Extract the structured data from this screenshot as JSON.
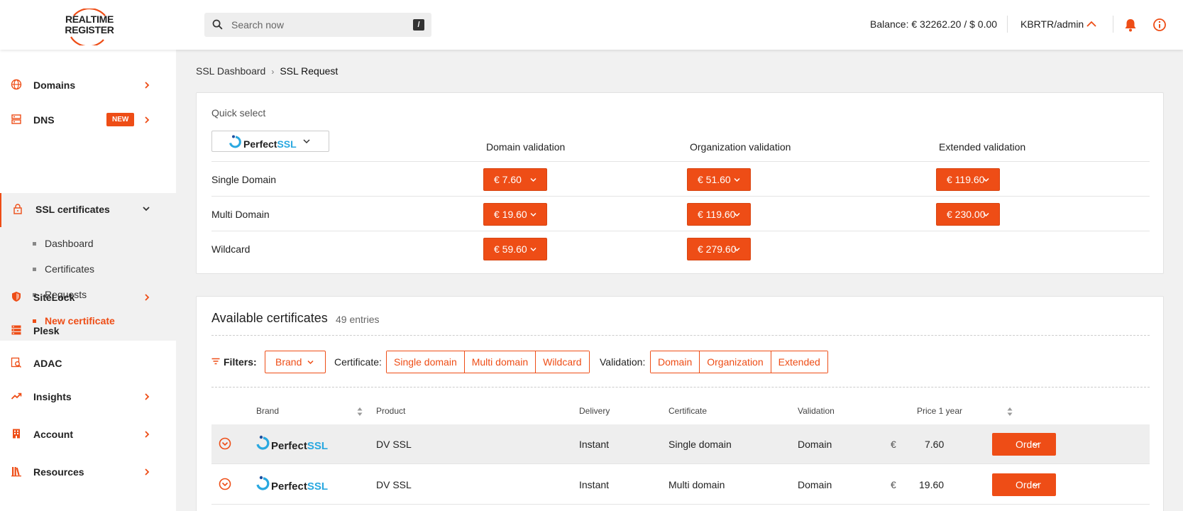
{
  "header": {
    "logo_line1": "REALTIME",
    "logo_line2": "REGISTER",
    "search_placeholder": "Search now",
    "search_shortcut": "/",
    "balance": "Balance: € 32262.20 / $ 0.00",
    "user": "KBRTR/admin"
  },
  "sidebar": {
    "items": [
      {
        "label": "Domains"
      },
      {
        "label": "DNS",
        "badge": "NEW"
      },
      {
        "label": "SSL certificates"
      },
      {
        "label": "SiteLock"
      },
      {
        "label": "Plesk"
      },
      {
        "label": "ADAC"
      },
      {
        "label": "Insights"
      },
      {
        "label": "Account"
      },
      {
        "label": "Resources"
      }
    ],
    "ssl_sub": [
      "Dashboard",
      "Certificates",
      "Requests",
      "New certificate"
    ]
  },
  "breadcrumb": {
    "parent": "SSL Dashboard",
    "separator": "›",
    "current": "SSL Request"
  },
  "quick_select": {
    "title": "Quick select",
    "brand": {
      "part1": "Perfect",
      "part2": "SSL"
    },
    "columns": [
      "Domain validation",
      "Organization validation",
      "Extended validation"
    ],
    "rows": [
      {
        "label": "Single Domain",
        "dv": "€ 7.60",
        "ov": "€ 51.60",
        "ev": "€ 119.60"
      },
      {
        "label": "Multi Domain",
        "dv": "€ 19.60",
        "ov": "€ 119.60",
        "ev": "€ 230.00"
      },
      {
        "label": "Wildcard",
        "dv": "€ 59.60",
        "ov": "€ 279.60"
      }
    ]
  },
  "available": {
    "title": "Available certificates",
    "count": "49 entries",
    "filters_label": "Filters:",
    "brand_filter": "Brand",
    "certificate_label": "Certificate:",
    "certificate_options": [
      "Single domain",
      "Multi domain",
      "Wildcard"
    ],
    "validation_label": "Validation:",
    "validation_options": [
      "Domain",
      "Organization",
      "Extended"
    ],
    "columns": [
      "Brand",
      "Product",
      "Delivery",
      "Certificate",
      "Validation",
      "Price 1 year"
    ],
    "rows": [
      {
        "brand1": "Perfect",
        "brand2": "SSL",
        "product": "DV SSL",
        "delivery": "Instant",
        "certificate": "Single domain",
        "validation": "Domain",
        "currency": "€",
        "price": "7.60",
        "action": "Order"
      },
      {
        "brand1": "Perfect",
        "brand2": "SSL",
        "product": "DV SSL",
        "delivery": "Instant",
        "certificate": "Multi domain",
        "validation": "Domain",
        "currency": "€",
        "price": "19.60",
        "action": "Order"
      }
    ]
  },
  "colors": {
    "accent": "#ee4d16",
    "pssl_blue": "#29a8e0"
  }
}
